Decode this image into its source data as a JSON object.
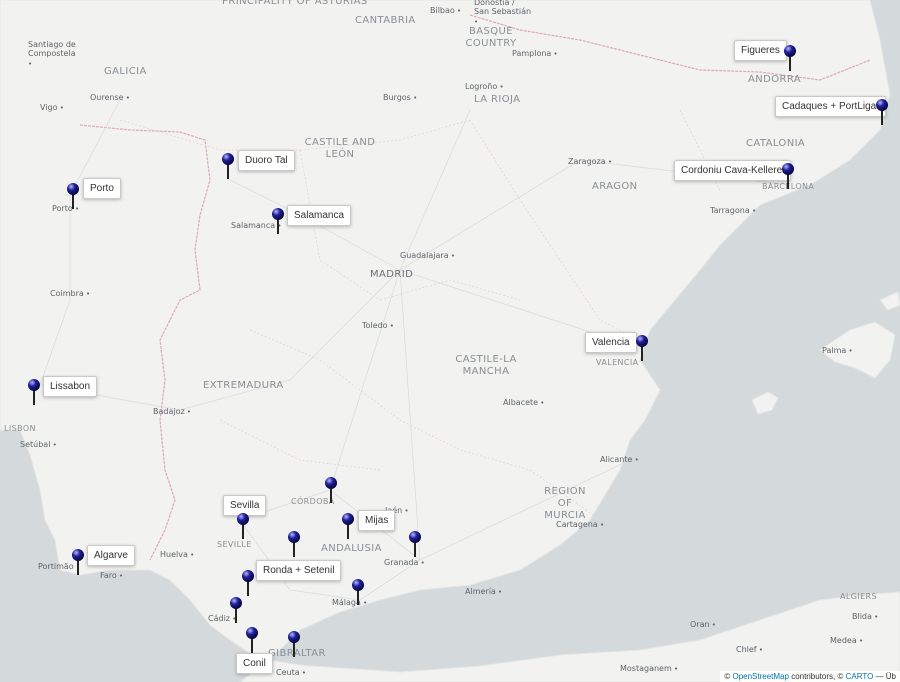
{
  "colors": {
    "sea": "#d4dadc",
    "land": "#f2f2f0",
    "border": "#e0a8b8",
    "marker": "#1e1e9a"
  },
  "regions": [
    {
      "name": "PRINCIPALITY OF ASTURIAS"
    },
    {
      "name": "CANTABRIA"
    },
    {
      "name": "BASQUE COUNTRY"
    },
    {
      "name": "GALICIA"
    },
    {
      "name": "LA RIOJA"
    },
    {
      "name": "ANDORRA"
    },
    {
      "name": "CASTILE AND LEÓN"
    },
    {
      "name": "CATALONIA"
    },
    {
      "name": "ARAGON"
    },
    {
      "name": "MADRID"
    },
    {
      "name": "CASTILE-LA MANCHA"
    },
    {
      "name": "EXTREMADURA"
    },
    {
      "name": "REGION OF MURCIA"
    },
    {
      "name": "ANDALUSIA"
    },
    {
      "name": "CÓRDOBA"
    },
    {
      "name": "SEVILLE"
    },
    {
      "name": "GIBRALTAR"
    },
    {
      "name": "LISBON"
    },
    {
      "name": "VALENCIA"
    },
    {
      "name": "BARCELONA"
    },
    {
      "name": "ALGIERS"
    }
  ],
  "cities": [
    {
      "name": "Bilbao"
    },
    {
      "name": "Donostia / San Sebastián"
    },
    {
      "name": "Santiago de Compostela"
    },
    {
      "name": "Pamplona"
    },
    {
      "name": "Ourense"
    },
    {
      "name": "Logroño"
    },
    {
      "name": "Vigo"
    },
    {
      "name": "Burgos"
    },
    {
      "name": "Zaragoza"
    },
    {
      "name": "Tarragona"
    },
    {
      "name": "Guadalajara"
    },
    {
      "name": "Coimbra"
    },
    {
      "name": "Toledo"
    },
    {
      "name": "Palma"
    },
    {
      "name": "Albacete"
    },
    {
      "name": "Badajoz"
    },
    {
      "name": "Setúbal"
    },
    {
      "name": "Alicante"
    },
    {
      "name": "Jaén"
    },
    {
      "name": "Cartagena"
    },
    {
      "name": "Huelva"
    },
    {
      "name": "Portimão"
    },
    {
      "name": "Faro"
    },
    {
      "name": "Granada"
    },
    {
      "name": "Almería"
    },
    {
      "name": "Málaga"
    },
    {
      "name": "Cádiz"
    },
    {
      "name": "Ceuta"
    },
    {
      "name": "Oran"
    },
    {
      "name": "Chlef"
    },
    {
      "name": "Medea"
    },
    {
      "name": "Blida"
    },
    {
      "name": "Mostaganem"
    },
    {
      "name": "Salamanca"
    },
    {
      "name": "Porto"
    }
  ],
  "markers": [
    {
      "label": "Figueres"
    },
    {
      "label": "Cadaques + PortLigat"
    },
    {
      "label": "Cordoniu Cava-Kellerei"
    },
    {
      "label": "Duoro Tal"
    },
    {
      "label": "Porto"
    },
    {
      "label": "Salamanca"
    },
    {
      "label": "Valencia"
    },
    {
      "label": "Lissabon"
    },
    {
      "label": "Sevilla"
    },
    {
      "label": "Mijas"
    },
    {
      "label": "Algarve"
    },
    {
      "label": "Ronda + Setenil"
    },
    {
      "label": "Conil"
    }
  ],
  "attribution": {
    "prefix": "©",
    "osm": "OpenStreetMap",
    "contributors": "contributors,",
    "prefix2": "©",
    "carto": "CARTO",
    "suffix": "— Üb"
  }
}
